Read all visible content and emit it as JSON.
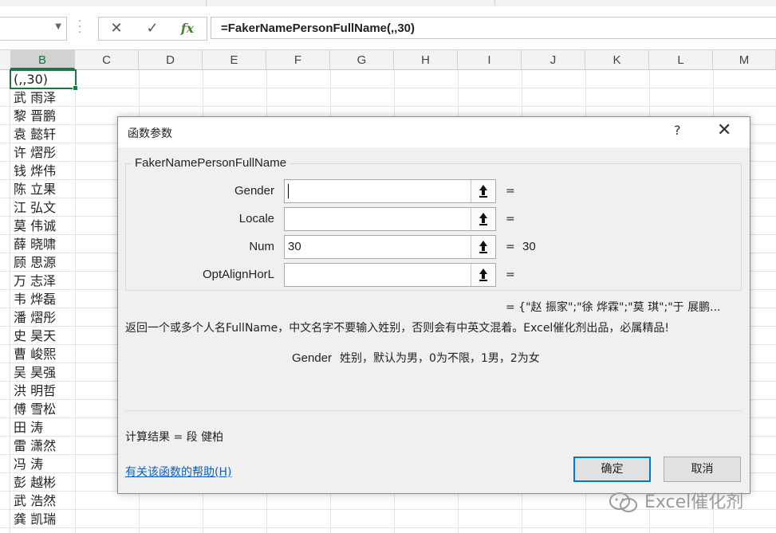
{
  "formula_bar": {
    "formula": "=FakerNamePersonFullName(,,30)",
    "cancel_icon": "✕",
    "enter_icon": "✓",
    "fx_label": "fx"
  },
  "columns": [
    "B",
    "C",
    "D",
    "E",
    "F",
    "G",
    "H",
    "I",
    "J",
    "K",
    "L",
    "M"
  ],
  "selected_column": "B",
  "cells_b": [
    "(,,30)",
    "武 雨泽",
    "黎 晋鹏",
    "袁 懿轩",
    "许 熠彤",
    "钱 烨伟",
    "陈 立果",
    "江 弘文",
    "莫 伟诚",
    "薛 晓啸",
    "顾 思源",
    "万 志泽",
    "韦 烨磊",
    "潘 熠彤",
    "史 昊天",
    "曹 峻熙",
    "吴 昊强",
    "洪 明哲",
    "傅 雪松",
    "田 涛",
    "雷 潇然",
    "冯 涛",
    "彭 越彬",
    "武 浩然",
    "龚 凯瑞"
  ],
  "dialog": {
    "title": "函数参数",
    "help_char": "?",
    "close_char": "✕",
    "function_name": "FakerNamePersonFullName",
    "args": [
      {
        "label": "Gender",
        "value": "",
        "eq": "=",
        "result": ""
      },
      {
        "label": "Locale",
        "value": "",
        "eq": "=",
        "result": ""
      },
      {
        "label": "Num",
        "value": "30",
        "eq": "=",
        "result": "30"
      },
      {
        "label": "OptAlignHorL",
        "value": "",
        "eq": "=",
        "result": ""
      }
    ],
    "preview": "=  {\"赵 振家\";\"徐 烨霖\";\"莫 琪\";\"于 展鹏...",
    "description": "返回一个或多个人名FullName，中文名字不要输入姓别，否则会有中英文混着。Excel催化剂出品，必属精品!",
    "arg_help_name": "Gender",
    "arg_help_text": "姓别，默认为男，0为不限，1男，2为女",
    "calc_result": "计算结果 =   段 健柏",
    "help_link": "有关该函数的帮助(H)",
    "ok_label": "确定",
    "cancel_label": "取消"
  },
  "watermark": "Excel催化剂"
}
